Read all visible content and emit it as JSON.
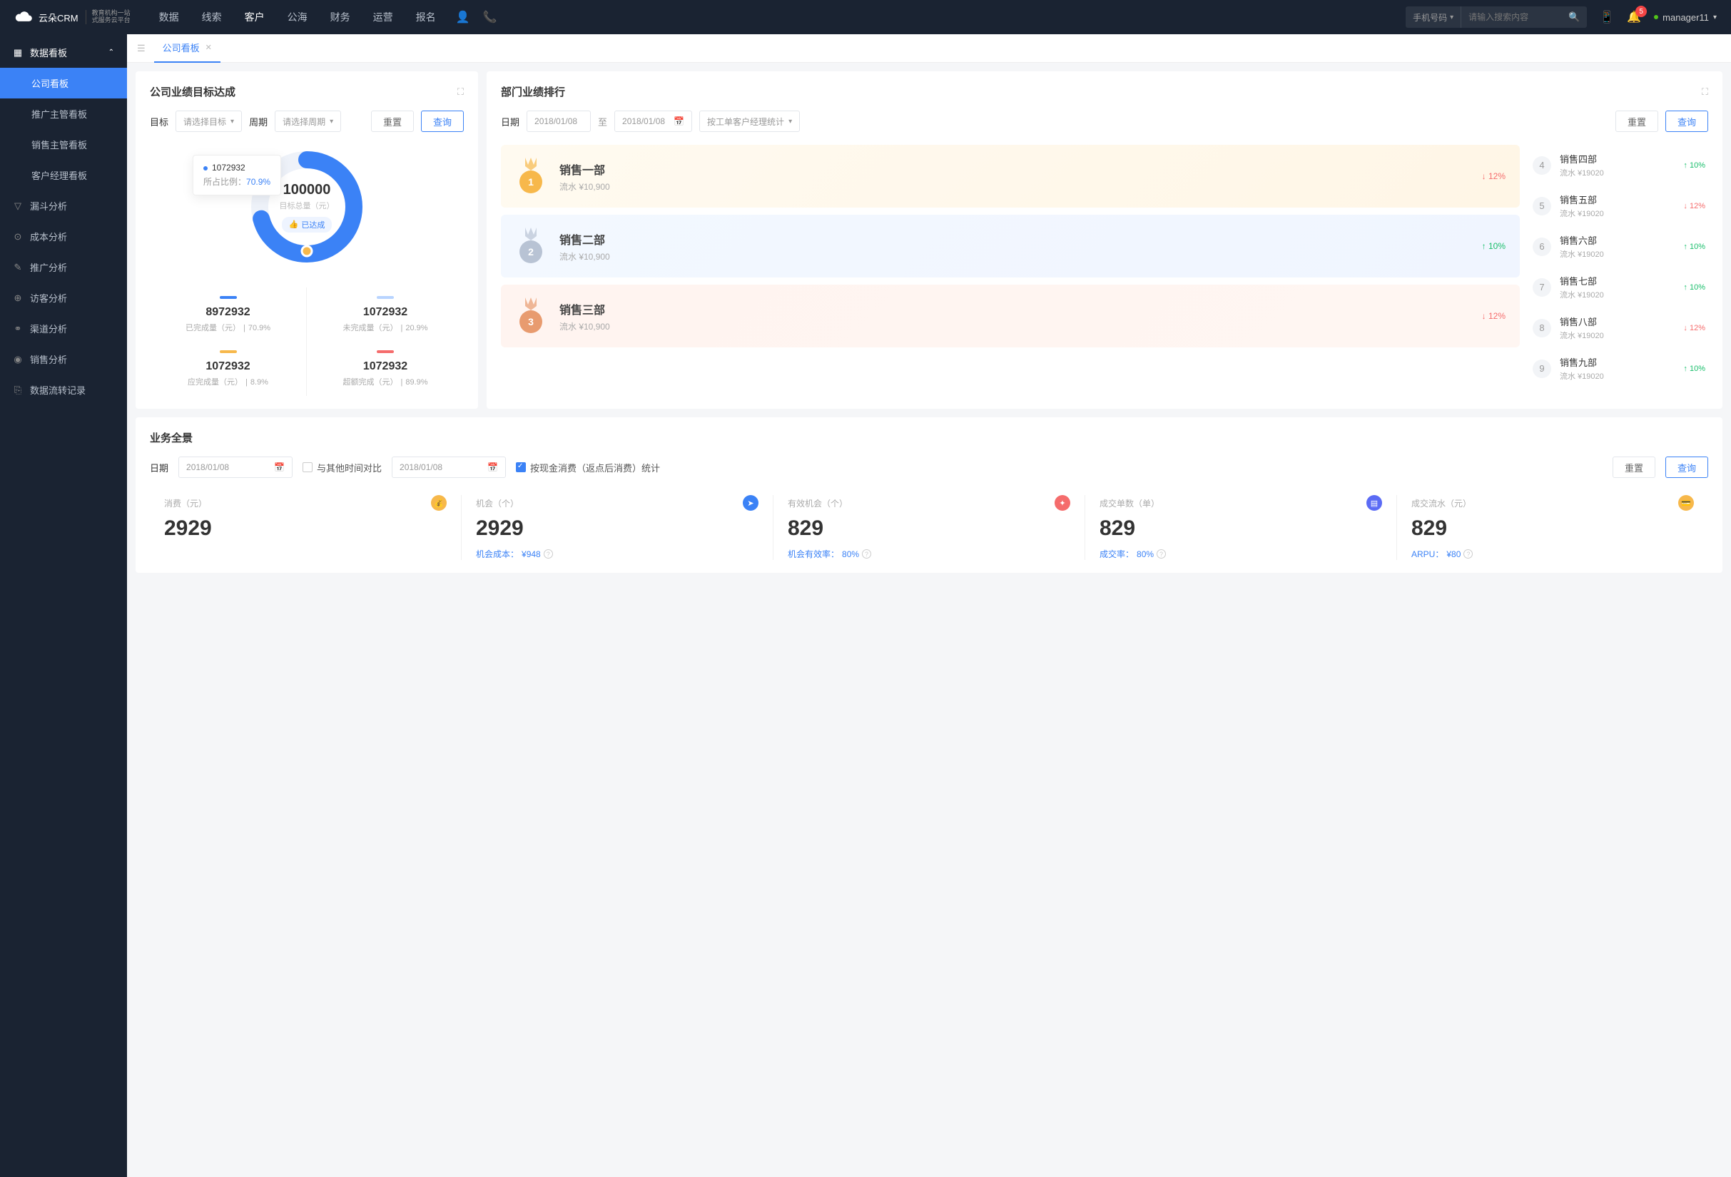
{
  "logo": {
    "brand": "云朵CRM",
    "sub1": "教育机构一站",
    "sub2": "式服务云平台"
  },
  "nav": [
    "数据",
    "线索",
    "客户",
    "公海",
    "财务",
    "运营",
    "报名"
  ],
  "nav_active_index": 2,
  "search": {
    "type": "手机号码",
    "placeholder": "请输入搜索内容"
  },
  "notif_count": "5",
  "user": "manager11",
  "sidebar": {
    "parent": "数据看板",
    "children": [
      "公司看板",
      "推广主管看板",
      "销售主管看板",
      "客户经理看板"
    ],
    "active_child": 0,
    "others": [
      "漏斗分析",
      "成本分析",
      "推广分析",
      "访客分析",
      "渠道分析",
      "销售分析",
      "数据流转记录"
    ]
  },
  "tab": "公司看板",
  "target": {
    "title": "公司业绩目标达成",
    "filter_target": "目标",
    "filter_target_ph": "请选择目标",
    "filter_period": "周期",
    "filter_period_ph": "请选择周期",
    "btn_reset": "重置",
    "btn_query": "查询",
    "donut_value": "100000",
    "donut_label": "目标总量（元）",
    "donut_tag": "已达成",
    "tip_value": "1072932",
    "tip_ratio_label": "所占比例：",
    "tip_ratio": "70.9%",
    "stats": [
      {
        "color": "#3b82f6",
        "val": "8972932",
        "lbl": "已完成量（元）",
        "pct": "70.9%"
      },
      {
        "color": "#b8d4ff",
        "val": "1072932",
        "lbl": "未完成量（元）",
        "pct": "20.9%"
      },
      {
        "color": "#f7b84b",
        "val": "1072932",
        "lbl": "应完成量（元）",
        "pct": "8.9%"
      },
      {
        "color": "#f56c6c",
        "val": "1072932",
        "lbl": "超额完成（元）",
        "pct": "89.9%"
      }
    ]
  },
  "rank": {
    "title": "部门业绩排行",
    "filter_date": "日期",
    "date_from": "2018/01/08",
    "date_sep": "至",
    "date_to": "2018/01/08",
    "group_by": "按工单客户经理统计",
    "btn_reset": "重置",
    "btn_query": "查询",
    "top3": [
      {
        "name": "销售一部",
        "sub": "流水 ¥10,900",
        "chg": "12%",
        "dir": "down"
      },
      {
        "name": "销售二部",
        "sub": "流水 ¥10,900",
        "chg": "10%",
        "dir": "up"
      },
      {
        "name": "销售三部",
        "sub": "流水 ¥10,900",
        "chg": "12%",
        "dir": "down"
      }
    ],
    "list": [
      {
        "rank": "4",
        "name": "销售四部",
        "sub": "流水 ¥19020",
        "chg": "10%",
        "dir": "up"
      },
      {
        "rank": "5",
        "name": "销售五部",
        "sub": "流水 ¥19020",
        "chg": "12%",
        "dir": "down"
      },
      {
        "rank": "6",
        "name": "销售六部",
        "sub": "流水 ¥19020",
        "chg": "10%",
        "dir": "up"
      },
      {
        "rank": "7",
        "name": "销售七部",
        "sub": "流水 ¥19020",
        "chg": "10%",
        "dir": "up"
      },
      {
        "rank": "8",
        "name": "销售八部",
        "sub": "流水 ¥19020",
        "chg": "12%",
        "dir": "down"
      },
      {
        "rank": "9",
        "name": "销售九部",
        "sub": "流水 ¥19020",
        "chg": "10%",
        "dir": "up"
      }
    ]
  },
  "pano": {
    "title": "业务全景",
    "filter_date": "日期",
    "date1": "2018/01/08",
    "compare_label": "与其他时间对比",
    "date2": "2018/01/08",
    "stat_label": "按现金消费（返点后消费）统计",
    "btn_reset": "重置",
    "btn_query": "查询",
    "metrics": [
      {
        "lbl": "消费（元）",
        "val": "2929",
        "sub": "",
        "icon_bg": "#f7b84b",
        "icon": "💰"
      },
      {
        "lbl": "机会（个）",
        "val": "2929",
        "sub_k": "机会成本：",
        "sub_v": "¥948",
        "icon_bg": "#3b82f6",
        "icon": "➤"
      },
      {
        "lbl": "有效机会（个）",
        "val": "829",
        "sub_k": "机会有效率：",
        "sub_v": "80%",
        "icon_bg": "#f56c6c",
        "icon": "✦"
      },
      {
        "lbl": "成交单数（单）",
        "val": "829",
        "sub_k": "成交率：",
        "sub_v": "80%",
        "icon_bg": "#5b6bf5",
        "icon": "▤"
      },
      {
        "lbl": "成交流水（元）",
        "val": "829",
        "sub_k": "ARPU：",
        "sub_v": "¥80",
        "icon_bg": "#f7b84b",
        "icon": "💳"
      }
    ]
  },
  "chart_data": {
    "type": "pie",
    "title": "目标总量（元）100000",
    "series": [
      {
        "name": "已完成量（元）",
        "value": 8972932,
        "pct": 70.9,
        "color": "#3b82f6"
      },
      {
        "name": "未完成量（元）",
        "value": 1072932,
        "pct": 20.9,
        "color": "#b8d4ff"
      },
      {
        "name": "应完成量（元）",
        "value": 1072932,
        "pct": 8.9,
        "color": "#f7b84b"
      },
      {
        "name": "超额完成（元）",
        "value": 1072932,
        "pct": 89.9,
        "color": "#f56c6c"
      }
    ]
  }
}
